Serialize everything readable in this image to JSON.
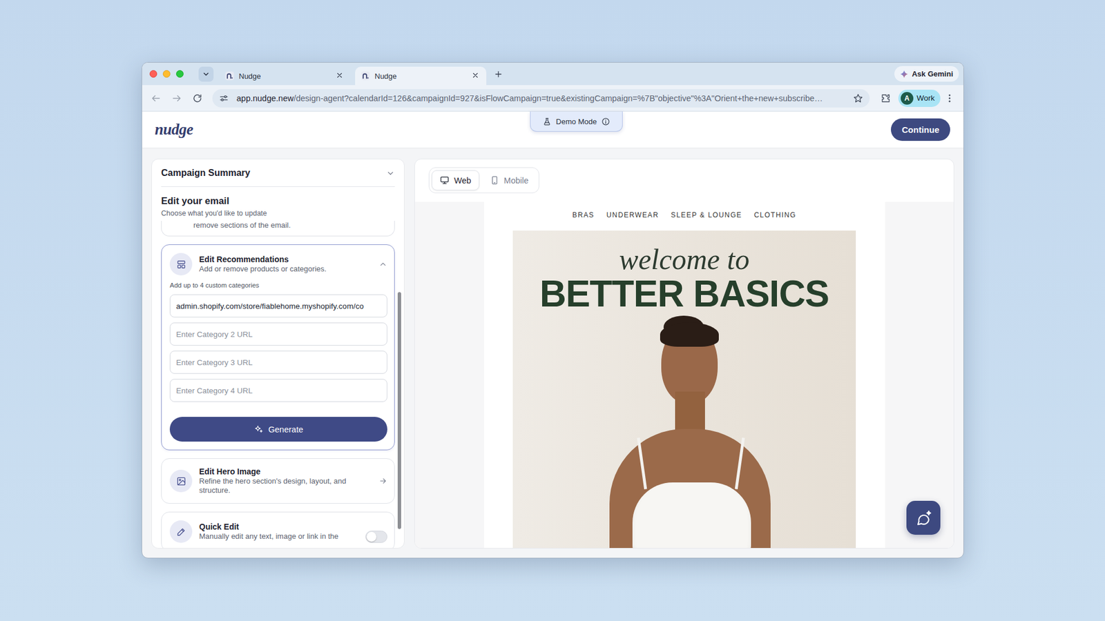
{
  "browser": {
    "tabs": [
      {
        "label": "Nudge",
        "selected": false
      },
      {
        "label": "Nudge",
        "selected": true
      }
    ],
    "url_host": "app.nudge.new",
    "url_rest": "/design-agent?calendarId=126&campaignId=927&isFlowCampaign=true&existingCampaign=%7B\"objective\"%3A\"Orient+the+new+subscribe…",
    "gemini": "Ask Gemini",
    "profile": {
      "initial": "A",
      "label": "Work"
    }
  },
  "header": {
    "logo": "nudge",
    "demo_badge": "Demo Mode",
    "continue_button": "Continue"
  },
  "sidebar": {
    "summary": {
      "title": "Campaign Summary",
      "expanded": false
    },
    "heading": "Edit your email",
    "subheading": "Choose what you'd like to update",
    "cards": [
      {
        "kind": "clipped",
        "description": "remove sections of the email."
      },
      {
        "kind": "recommendations",
        "title": "Edit Recommendations",
        "description": "Add or remove products or categories.",
        "expanded": true,
        "hint": "Add up to 4 custom categories",
        "fields": [
          {
            "value": "admin.shopify.com/store/fiablehome.myshopify.com/co"
          },
          {
            "placeholder": "Enter Category 2 URL"
          },
          {
            "placeholder": "Enter Category 3 URL"
          },
          {
            "placeholder": "Enter Category 4 URL"
          }
        ],
        "button": "Generate"
      },
      {
        "kind": "link",
        "title": "Edit Hero Image",
        "description": "Refine the hero section's design, layout, and structure."
      },
      {
        "kind": "toggle",
        "title": "Quick Edit",
        "description": "Manually edit any text, image or link in the",
        "on": false
      }
    ]
  },
  "preview": {
    "views": [
      {
        "label": "Web",
        "selected": true
      },
      {
        "label": "Mobile",
        "selected": false
      }
    ],
    "email": {
      "nav": [
        "BRAS",
        "UNDERWEAR",
        "SLEEP & LOUNGE",
        "CLOTHING"
      ],
      "hero": {
        "kicker": "welcome to",
        "title": "BETTER BASICS"
      }
    }
  }
}
